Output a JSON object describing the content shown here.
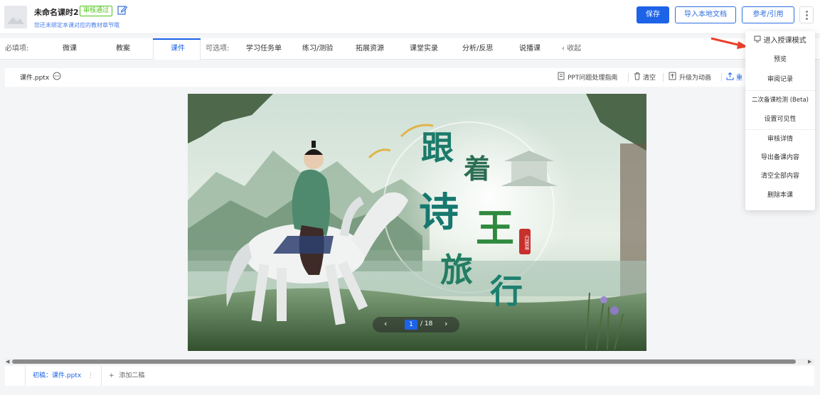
{
  "header": {
    "title": "未命名课时2",
    "status_badge": "审核通过",
    "bind_hint": "您还未绑定本课对应的教材章节哦",
    "save_label": "保存",
    "import_label": "导入本地文档",
    "reference_label": "参考/引用"
  },
  "tabs": {
    "required_label": "必填项:",
    "required": [
      "微课",
      "教案",
      "课件"
    ],
    "optional_label": "可选项:",
    "optional": [
      "学习任务单",
      "练习/测验",
      "拓展资源",
      "课堂实录",
      "分析/反思",
      "说播课"
    ],
    "collapse_label": "收起",
    "active": "课件"
  },
  "file_toolbar": {
    "file_name": "课件.pptx",
    "ppt_guide": "PPT问题处理指南",
    "clear": "清空",
    "upgrade": "升级为动画",
    "reupload": "重"
  },
  "slide": {
    "title_chars": [
      "跟",
      "着",
      "诗",
      "王",
      "旅",
      "行"
    ],
    "seal_text": "白居易"
  },
  "pager": {
    "current": "1",
    "total": "/ 18"
  },
  "drafts": {
    "first_draft": "初稿：课件.pptx",
    "add_draft": "添加二稿"
  },
  "dropdown": {
    "items": [
      "进入授课模式",
      "预览",
      "审阅记录",
      "二次备课检测 (Beta)",
      "设置可见性",
      "审核详情",
      "导出备课内容",
      "清空全部内容",
      "删除本课"
    ]
  },
  "colors": {
    "primary": "#1d63e8",
    "success": "#52c41a",
    "arrow": "#e8412c"
  }
}
